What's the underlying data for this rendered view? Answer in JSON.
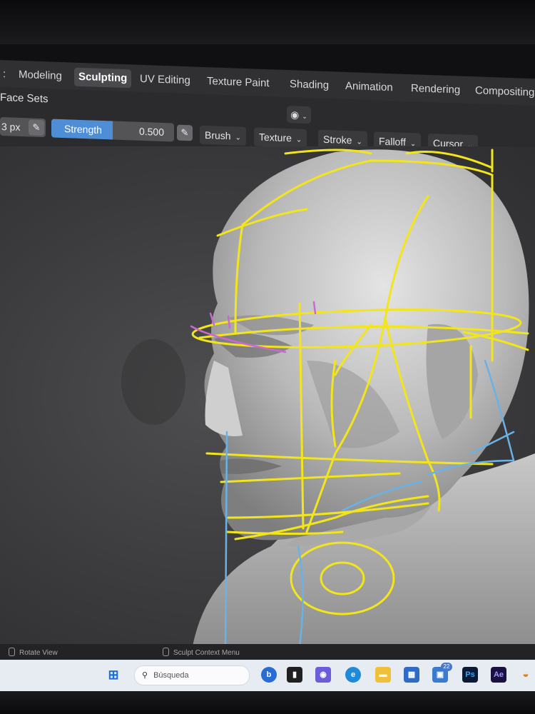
{
  "workspace_tabs": [
    {
      "label": "Modeling",
      "active": false
    },
    {
      "label": "Sculpting",
      "active": true
    },
    {
      "label": "UV Editing",
      "active": false
    },
    {
      "label": "Texture Paint",
      "active": false
    },
    {
      "label": "Shading",
      "active": false
    },
    {
      "label": "Animation",
      "active": false
    },
    {
      "label": "Rendering",
      "active": false
    },
    {
      "label": "Compositing",
      "active": false
    }
  ],
  "header": {
    "face_sets": "Face Sets",
    "radius_value": "3 px",
    "strength_label": "Strength",
    "strength_value": "0.500",
    "strength_fraction": 0.5,
    "mode_icon": "sphere-mode-icon",
    "menus": [
      "Brush",
      "Texture",
      "Stroke",
      "Falloff",
      "Cursor"
    ]
  },
  "status_bar": {
    "left": "Rotate View",
    "middle": "Sculpt Context Menu"
  },
  "taskbar": {
    "search_placeholder": "Búsqueda",
    "notification_count": "22",
    "apps": [
      "windows-start-icon",
      "search-icon",
      "bing-icon",
      "media-icon",
      "chat-icon",
      "edge-icon",
      "file-explorer-icon",
      "store-icon",
      "photos-icon",
      "photoshop-icon",
      "after-effects-icon",
      "blender-icon"
    ],
    "ps_label": "Ps",
    "ae_label": "Ae"
  },
  "colors": {
    "accent": "#4d8ed6",
    "guide_yellow": "#f2e51c",
    "guide_blue": "#6ab2e6",
    "guide_magenta": "#c86ad0"
  }
}
